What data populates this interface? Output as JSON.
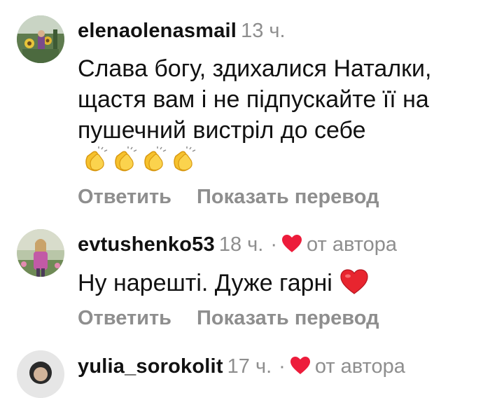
{
  "comments": [
    {
      "username": "elenaolenasmail",
      "time": "13 ч.",
      "text": "Слава богу, здихалися Наталки, щастя вам і не підпускайте її на пушечний вистріл до себе",
      "emoji": "clapping-hands x4",
      "reply_label": "Ответить",
      "translate_label": "Показать перевод",
      "liked_by_author": false
    },
    {
      "username": "evtushenko53",
      "time": "18 ч.",
      "separator": "·",
      "author_badge": "от автора",
      "text": "Ну нарешті. Дуже гарні",
      "emoji": "red-heart",
      "reply_label": "Ответить",
      "translate_label": "Показать перевод",
      "liked_by_author": true
    },
    {
      "username": "yulia_sorokolit",
      "time": "17 ч.",
      "separator": "·",
      "author_badge": "от автора",
      "liked_by_author": true
    }
  ],
  "colors": {
    "text": "#111111",
    "secondary": "#8e8e8e",
    "heart": "#ed1c3b"
  }
}
